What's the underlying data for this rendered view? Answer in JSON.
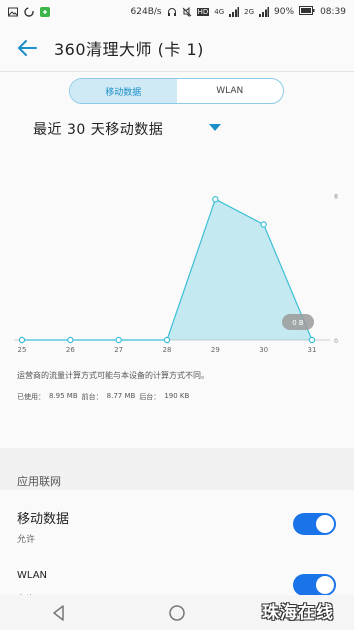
{
  "status_bar": {
    "network_speed": "624B/s",
    "network_type": "4G",
    "network_type_2": "2G",
    "battery": "90%",
    "time": "08:39"
  },
  "app_bar": {
    "title": "360清理大师 (卡 1)"
  },
  "tabs": [
    {
      "label": "移动数据",
      "active": true
    },
    {
      "label": "WLAN",
      "active": false
    }
  ],
  "period_label": "最近 30 天移动数据",
  "chart_data": {
    "type": "area",
    "categories": [
      "25",
      "26",
      "27",
      "28",
      "29",
      "30",
      "31"
    ],
    "values": [
      0,
      0,
      0,
      0,
      7.8,
      6.4,
      0
    ],
    "ylim": [
      0,
      8.7
    ],
    "y_ticks": [
      "0",
      "8"
    ],
    "tooltip": "0 B",
    "color": "#3cbfd6"
  },
  "note": "运营商的流量计算方式可能与本设备的计算方式不同。",
  "usage": {
    "used_label": "已使用：",
    "used_value": "8.95 MB",
    "foreground_label": "前台：",
    "foreground_value": "8.77 MB",
    "background_label": "后台：",
    "background_value": "190 KB"
  },
  "section": {
    "title": "应用联网"
  },
  "rows": [
    {
      "title": "移动数据",
      "subtitle": "允许",
      "enabled": true
    },
    {
      "title": "WLAN",
      "subtitle": "允许",
      "enabled": true
    }
  ],
  "watermark": "珠海在线",
  "colors": {
    "accent": "#1a8fc9",
    "toggle": "#1a73e8",
    "chart_line": "#3cbfd6"
  }
}
